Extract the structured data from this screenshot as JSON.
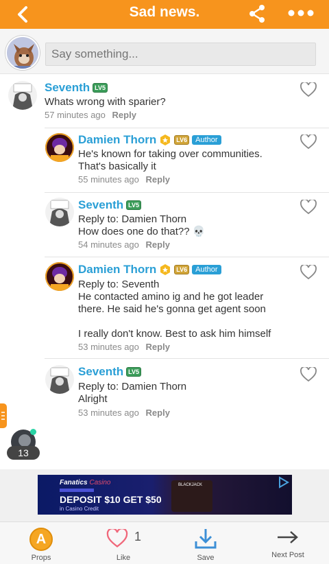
{
  "header": {
    "title": "Sad news.",
    "background": "#f7941d"
  },
  "composer": {
    "placeholder": "Say something..."
  },
  "comments": [
    {
      "name": "Seventh",
      "level": "LV5",
      "author_tag": "",
      "reply_to": "",
      "text": "Whats wrong with sparier?",
      "time": "57 minutes ago",
      "reply_label": "Reply"
    },
    {
      "name": "Damien Thorn",
      "level": "LV6",
      "author_tag": "Author",
      "reply_to": "",
      "text": "He's known for taking over communities.\nThat's basically it",
      "time": "55 minutes ago",
      "reply_label": "Reply"
    },
    {
      "name": "Seventh",
      "level": "LV5",
      "author_tag": "",
      "reply_to": "Reply to: Damien Thorn",
      "text": "How does one do that?? 💀",
      "time": "54 minutes ago",
      "reply_label": "Reply"
    },
    {
      "name": "Damien Thorn",
      "level": "LV6",
      "author_tag": "Author",
      "reply_to": "Reply to: Seventh",
      "text": "He contacted amino ig and he got leader\nthere. He said he's gonna get agent soon\n\nI really don't know. Best to ask him himself",
      "time": "53 minutes ago",
      "reply_label": "Reply"
    },
    {
      "name": "Seventh",
      "level": "LV5",
      "author_tag": "",
      "reply_to": "Reply to: Damien Thorn",
      "text": "Alright",
      "time": "53 minutes ago",
      "reply_label": "Reply"
    }
  ],
  "floating": {
    "online_count": "13"
  },
  "ad": {
    "brand": "Fanatics",
    "brand_sub": "Casino",
    "headline": "DEPOSIT $10 GET $50",
    "sub": "in Casino Credit",
    "game": "BLACKJACK"
  },
  "bottom_bar": {
    "props_label": "Props",
    "like_label": "Like",
    "like_count": "1",
    "save_label": "Save",
    "next_label": "Next Post"
  },
  "colors": {
    "accent": "#f7941d",
    "name_blue": "#2a9fd6",
    "level_green": "#3c9d5a",
    "level_gold": "#d1a53a"
  }
}
